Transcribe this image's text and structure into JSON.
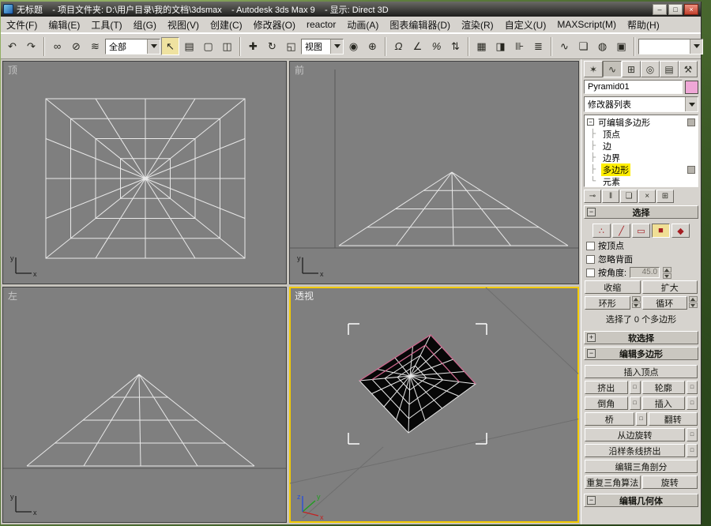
{
  "window": {
    "title": "无标题    - 项目文件夹: D:\\用户目录\\我的文档\\3dsmax    - Autodesk 3ds Max 9    - 显示: Direct 3D",
    "buttons": {
      "minimize": "–",
      "maximize": "□",
      "close": "×"
    }
  },
  "menu": {
    "items": [
      "文件(F)",
      "编辑(E)",
      "工具(T)",
      "组(G)",
      "视图(V)",
      "创建(C)",
      "修改器(O)",
      "reactor",
      "动画(A)",
      "图表编辑器(D)",
      "渲染(R)",
      "自定义(U)",
      "MAXScript(M)",
      "帮助(H)"
    ]
  },
  "toolbar": {
    "selection_filter": "全部",
    "ref_coord": "视图",
    "render_presets_value": "",
    "icons": {
      "undo": "↶",
      "redo": "↷",
      "select_link": "∞",
      "unlink": "⊘",
      "bind_spacewarp": "≋",
      "select_object": "↖",
      "select_by_name": "▤",
      "rect_region": "▢",
      "crossing": "◫",
      "move": "✚",
      "rotate": "↻",
      "scale": "◱",
      "use_pivot": "◉",
      "manipulate": "⊕",
      "snaps": "Ω",
      "angle_snap": "∠",
      "percent_snap": "%",
      "spinner_snap": "⇅",
      "named_sets": "▦",
      "mirror": "◨",
      "align": "⊪",
      "layers": "≣",
      "curve_editor": "∿",
      "schematic": "❏",
      "material_editor": "◍",
      "render_scene": "▣",
      "render_type": "◔",
      "quick_render": "◈"
    }
  },
  "icons": {
    "tab_create": "✶",
    "tab_modify": "∿",
    "tab_hierarchy": "⊞",
    "tab_motion": "◎",
    "tab_display": "▤",
    "tab_utilities": "⚒",
    "collapse": "−",
    "expand": "+",
    "settings_box": "□",
    "tree_branch": "├",
    "tree_end": "└",
    "pin": "⊸",
    "show_end_result": "‖",
    "make_unique": "❏",
    "remove_modifier": "×",
    "configure": "⊞",
    "sub_vertex": "∴",
    "sub_edge": "╱",
    "sub_border": "▭",
    "sub_polygon": "■",
    "sub_element": "◆"
  },
  "viewports": {
    "top_label": "顶",
    "front_label": "前",
    "left_label": "左",
    "persp_label": "透视",
    "axis": {
      "x": "x",
      "y": "y",
      "z": "z"
    }
  },
  "command_panel": {
    "object_name": "Pyramid01",
    "modifier_list": "修改器列表",
    "stack": {
      "root": "可编辑多边形",
      "items": [
        "顶点",
        "边",
        "边界",
        "多边形",
        "元素"
      ]
    },
    "selection": {
      "title": "选择",
      "by_vertex": "按顶点",
      "ignore_backfacing": "忽略背面",
      "by_angle": "按角度:",
      "angle_value": "45.0",
      "shrink": "收缩",
      "grow": "扩大",
      "ring": "环形",
      "loop": "循环",
      "status": "选择了 0 个多边形"
    },
    "soft_selection": {
      "title": "软选择"
    },
    "edit_polygons": {
      "title": "编辑多边形",
      "insert_vertex": "插入顶点",
      "extrude": "挤出",
      "outline": "轮廓",
      "bevel": "倒角",
      "inset": "插入",
      "bridge": "桥",
      "flip": "翻转",
      "hinge_from_edge": "从边旋转",
      "extrude_along_spline": "沿样条线挤出",
      "edit_triangulation": "编辑三角剖分",
      "retriangulate": "重复三角算法",
      "turn": "旋转"
    },
    "edit_geometry": {
      "title": "编辑几何体"
    }
  },
  "colors": {
    "active_viewport_border": "#f3cb00",
    "stack_highlight": "#ffee00",
    "viewport_bg": "#7f7f7f",
    "ui_bg": "#d6d3ce",
    "wireframe": "#e9e9e9",
    "subobject_red": "#a51d22",
    "object_color_swatch": "#efa7d6"
  }
}
